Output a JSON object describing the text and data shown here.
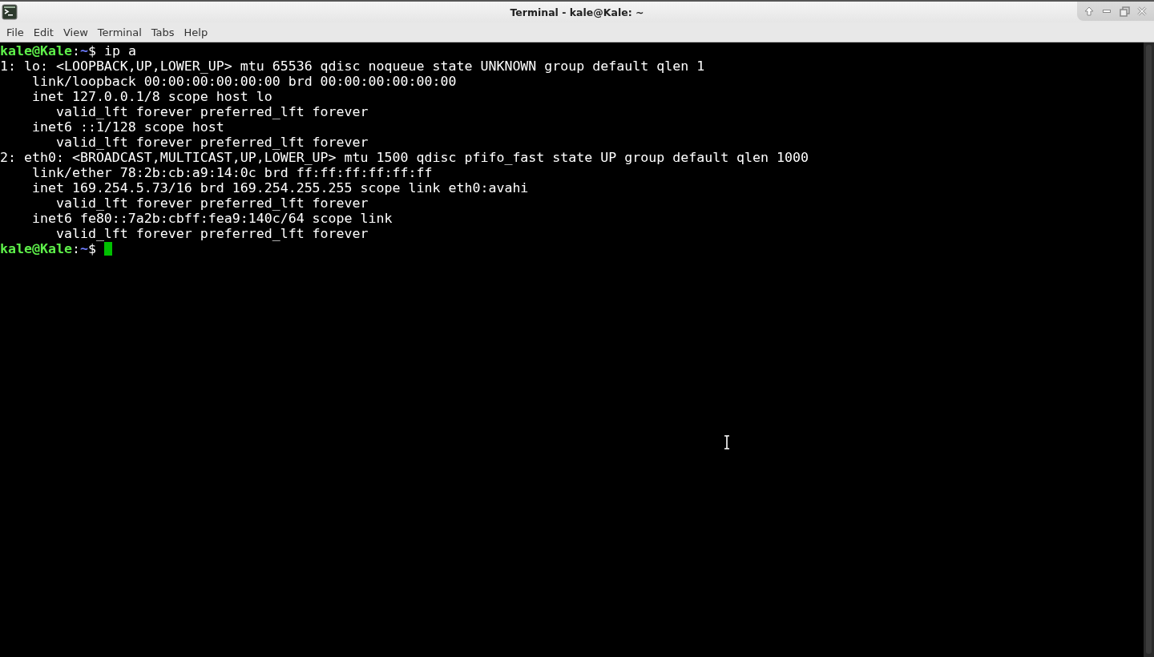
{
  "window": {
    "title": "Terminal - kale@Kale: ~"
  },
  "menu": [
    "File",
    "Edit",
    "View",
    "Terminal",
    "Tabs",
    "Help"
  ],
  "terminal": {
    "lines": [
      {
        "kind": "prompt",
        "user": "kale@Kale",
        "separator": ":",
        "path": "~",
        "symbol": "$",
        "command": "ip a"
      },
      {
        "kind": "output",
        "text": "1: lo: <LOOPBACK,UP,LOWER_UP> mtu 65536 qdisc noqueue state UNKNOWN group default qlen 1"
      },
      {
        "kind": "output",
        "text": "    link/loopback 00:00:00:00:00:00 brd 00:00:00:00:00:00"
      },
      {
        "kind": "output",
        "text": "    inet 127.0.0.1/8 scope host lo"
      },
      {
        "kind": "output",
        "text": "       valid_lft forever preferred_lft forever"
      },
      {
        "kind": "output",
        "text": "    inet6 ::1/128 scope host"
      },
      {
        "kind": "output",
        "text": "       valid_lft forever preferred_lft forever"
      },
      {
        "kind": "output",
        "text": "2: eth0: <BROADCAST,MULTICAST,UP,LOWER_UP> mtu 1500 qdisc pfifo_fast state UP group default qlen 1000"
      },
      {
        "kind": "output",
        "text": "    link/ether 78:2b:cb:a9:14:0c brd ff:ff:ff:ff:ff:ff"
      },
      {
        "kind": "output",
        "text": "    inet 169.254.5.73/16 brd 169.254.255.255 scope link eth0:avahi"
      },
      {
        "kind": "output",
        "text": "       valid_lft forever preferred_lft forever"
      },
      {
        "kind": "output",
        "text": "    inet6 fe80::7a2b:cbff:fea9:140c/64 scope link"
      },
      {
        "kind": "output",
        "text": "       valid_lft forever preferred_lft forever"
      },
      {
        "kind": "prompt",
        "user": "kale@Kale",
        "separator": ":",
        "path": "~",
        "symbol": "$",
        "cursor": true
      }
    ]
  }
}
